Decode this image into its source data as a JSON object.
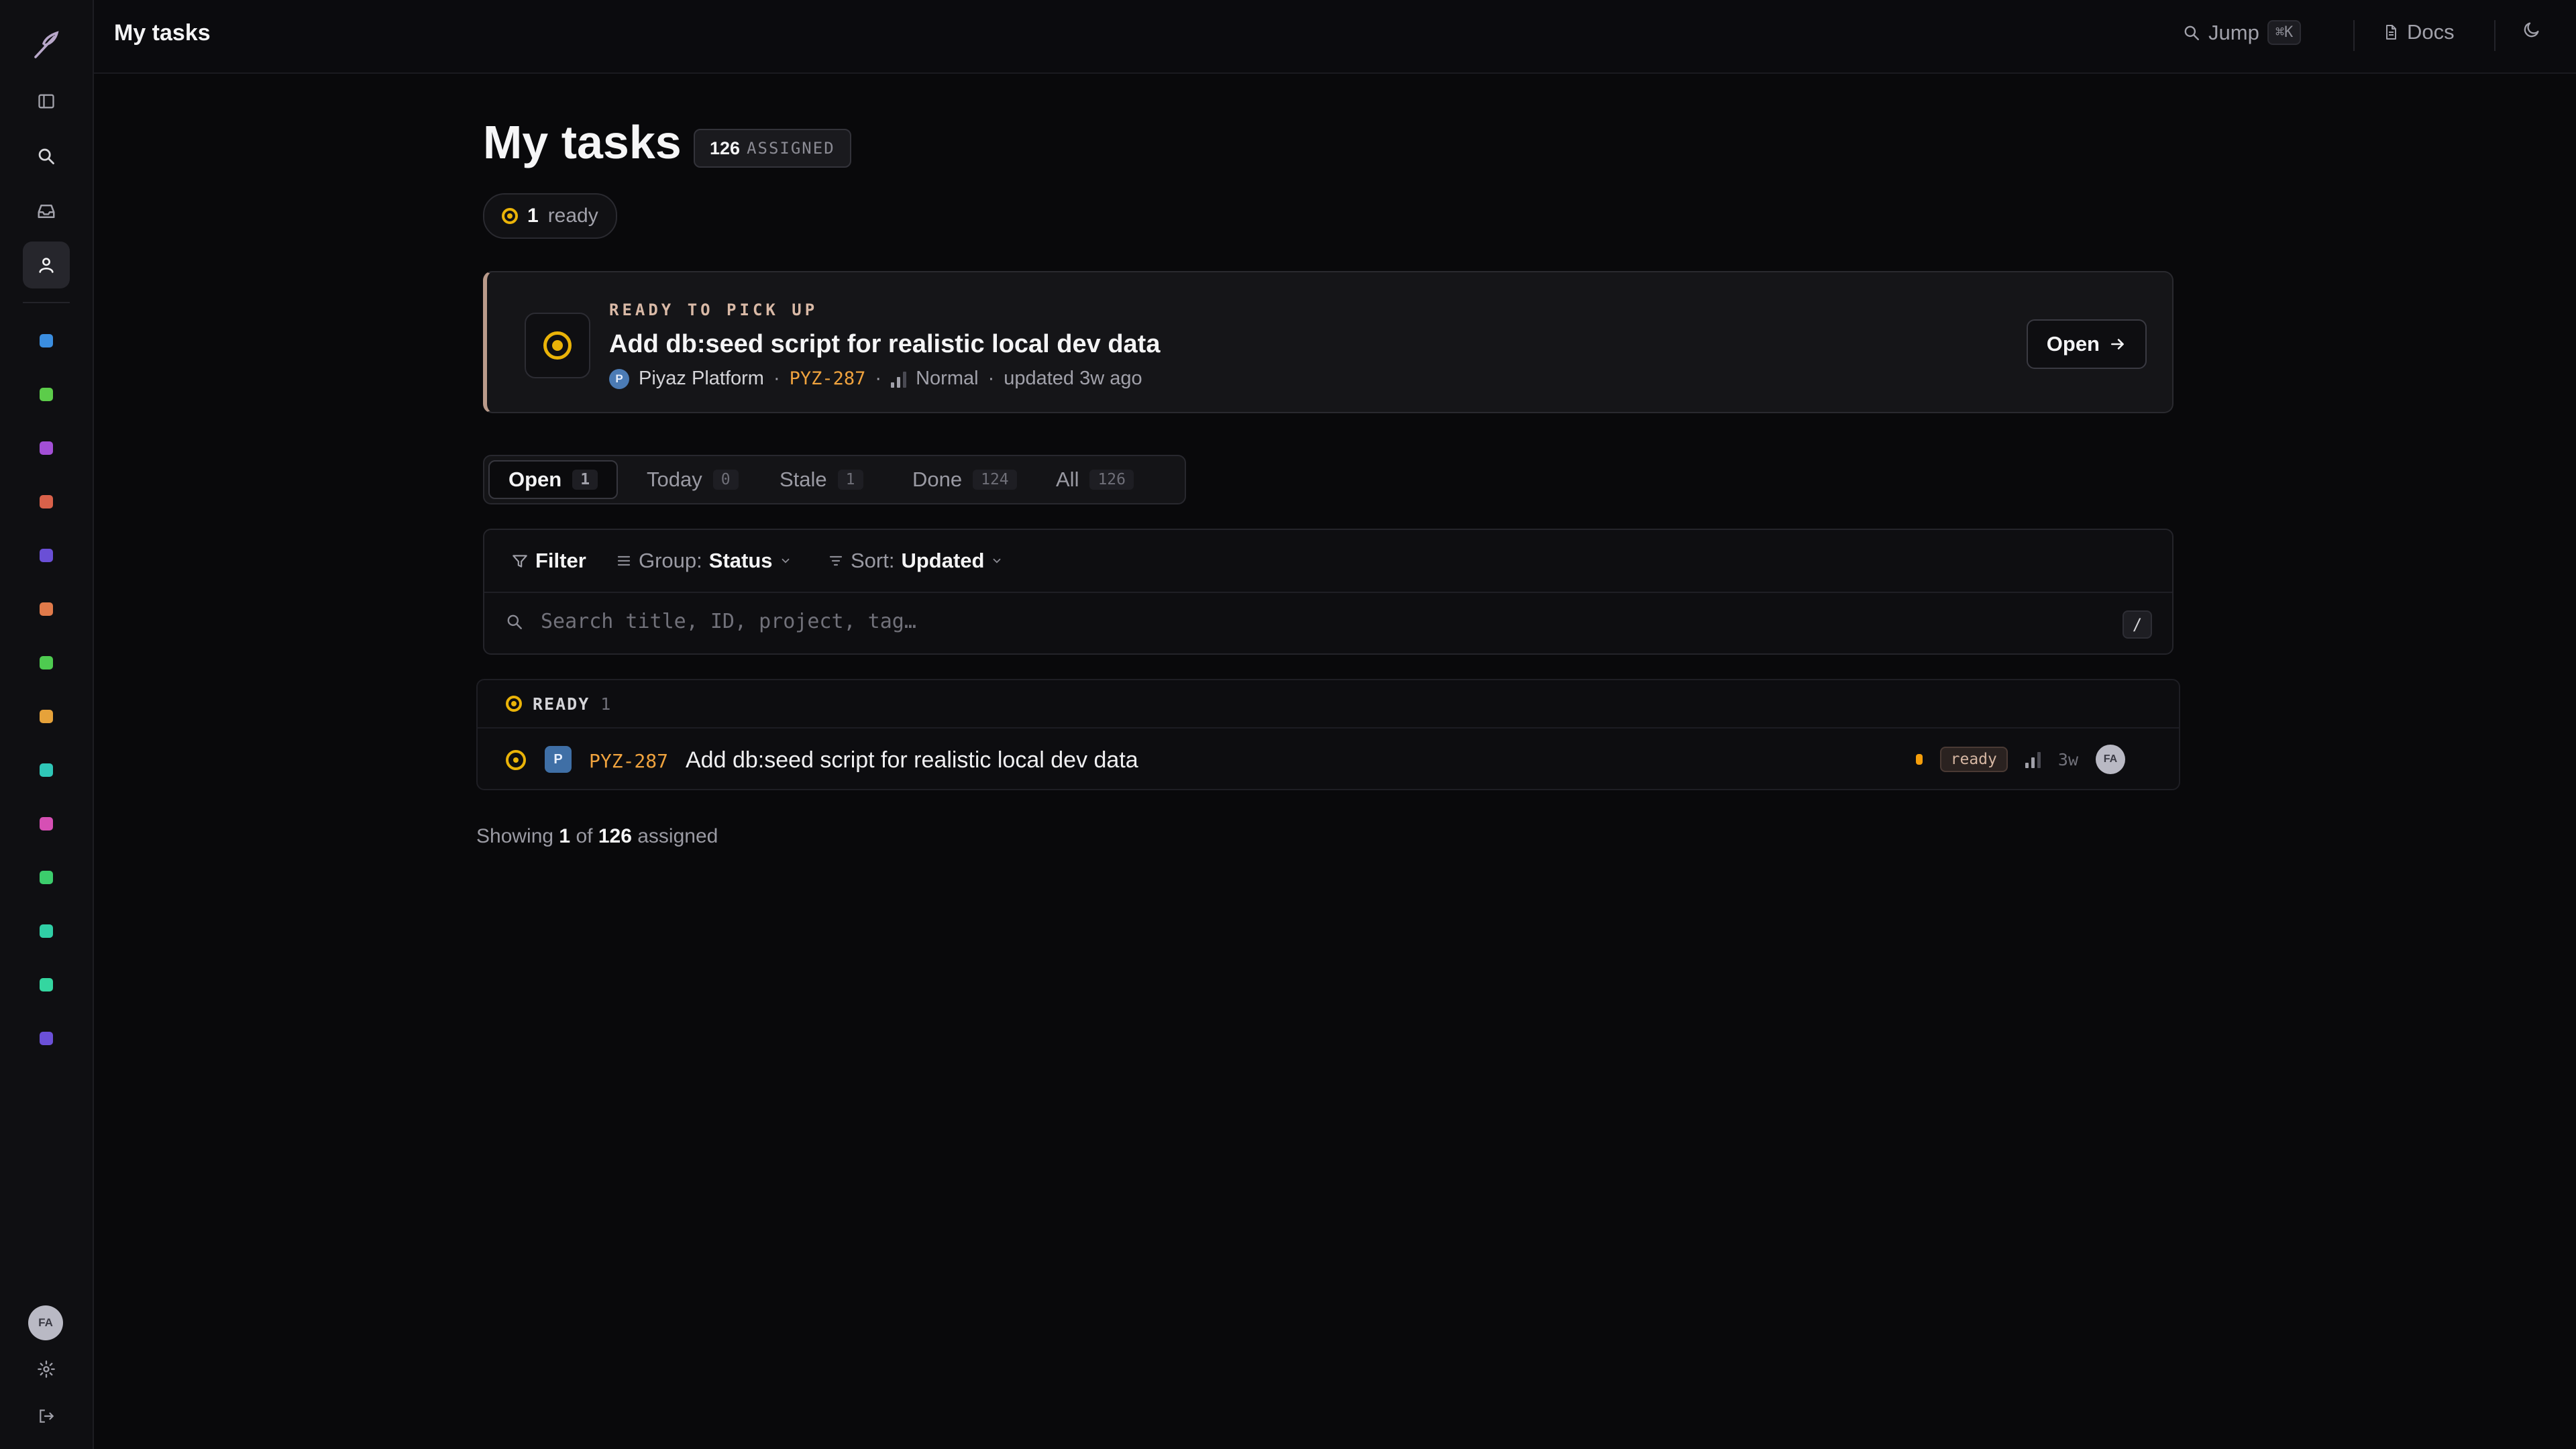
{
  "app": {
    "page_title": "My tasks"
  },
  "topbar": {
    "title": "My tasks",
    "jump_label": "Jump",
    "jump_shortcut": "⌘K",
    "docs_label": "Docs"
  },
  "sidebar": {
    "user_initials": "FA",
    "project_colors": [
      "#3b8ee0",
      "#5ccc4a",
      "#a34fd6",
      "#d9614a",
      "#6a4fd6",
      "#e07a4a",
      "#4ecb50",
      "#e6a23a",
      "#2fc7b8",
      "#d64fb4",
      "#3ccd6c",
      "#30cfa6",
      "#34d6a0",
      "#6b50d8"
    ]
  },
  "header": {
    "title": "My tasks",
    "assigned_count": "126",
    "assigned_label": "ASSIGNED",
    "ready_count": "1",
    "ready_label": "ready"
  },
  "ready_card": {
    "kicker": "READY TO PICK UP",
    "title": "Add db:seed script for realistic local dev data",
    "project_initial": "P",
    "project_name": "Piyaz Platform",
    "task_id": "PYZ-287",
    "priority": "Normal",
    "updated": "updated 3w ago",
    "open_label": "Open"
  },
  "tabs": [
    {
      "label": "Open",
      "count": "1"
    },
    {
      "label": "Today",
      "count": "0"
    },
    {
      "label": "Stale",
      "count": "1"
    },
    {
      "label": "Done",
      "count": "124"
    },
    {
      "label": "All",
      "count": "126"
    }
  ],
  "filters": {
    "filter_label": "Filter",
    "group_label": "Group:",
    "group_value": "Status",
    "sort_label": "Sort:",
    "sort_value": "Updated",
    "search_placeholder": "Search title, ID, project, tag…",
    "search_shortcut": "/"
  },
  "groups": [
    {
      "name": "READY",
      "count": "1",
      "rows": [
        {
          "project_initial": "P",
          "id": "PYZ-287",
          "title": "Add db:seed script for realistic local dev data",
          "status_tag": "ready",
          "age": "3w",
          "assignee": "FA"
        }
      ]
    }
  ],
  "footer": {
    "prefix": "Showing",
    "shown": "1",
    "of": "of",
    "total": "126",
    "suffix": "assigned"
  }
}
